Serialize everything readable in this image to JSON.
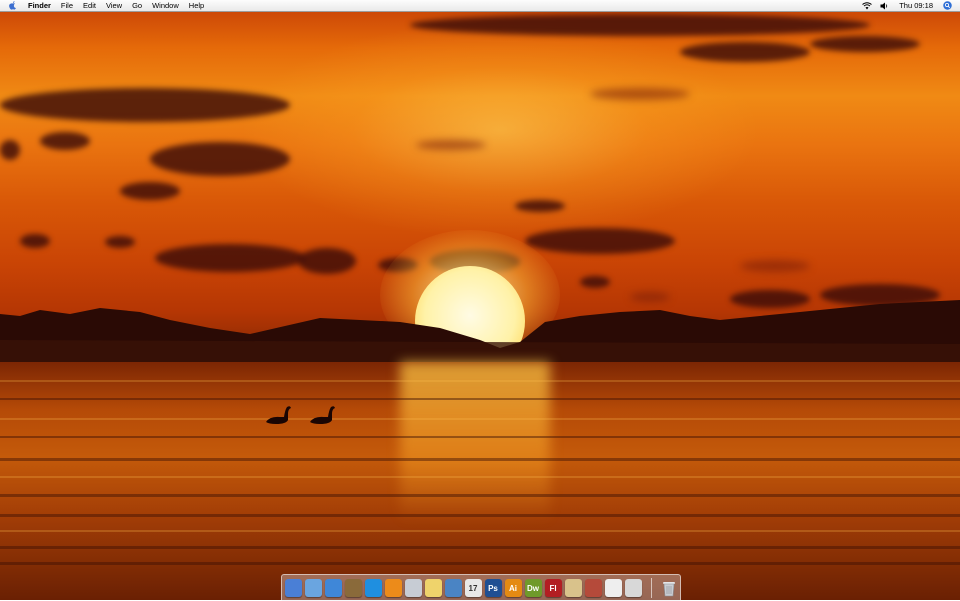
{
  "menubar": {
    "apple_icon": "apple-logo-icon",
    "app_name": "Finder",
    "menus": [
      "File",
      "Edit",
      "View",
      "Go",
      "Window",
      "Help"
    ],
    "status": {
      "wifi_icon": "wifi-icon",
      "volume_icon": "volume-icon",
      "clock": "Thu 09:18",
      "spotlight_icon": "spotlight-search-icon"
    }
  },
  "desktop": {
    "wallpaper": "sunset over water with two swans",
    "colors": {
      "sky": "#e56a09",
      "sun": "#fff2a8",
      "water": "#b54a07"
    }
  },
  "dock": {
    "items": [
      {
        "name": "finder",
        "icon": "finder-icon",
        "color": "#4a7fd6",
        "label": ""
      },
      {
        "name": "safari",
        "icon": "safari-compass-icon",
        "color": "#6aa5e0",
        "label": ""
      },
      {
        "name": "itunes",
        "icon": "itunes-music-icon",
        "color": "#3f87d8",
        "label": ""
      },
      {
        "name": "preview",
        "icon": "preview-photo-icon",
        "color": "#8a6a3a",
        "label": ""
      },
      {
        "name": "blue-app",
        "icon": "blue-circle-app-icon",
        "color": "#1f8fe0",
        "label": ""
      },
      {
        "name": "vlc",
        "icon": "vlc-cone-icon",
        "color": "#ec8b1a",
        "label": ""
      },
      {
        "name": "mail",
        "icon": "mail-pen-icon",
        "color": "#c7ccd4",
        "label": ""
      },
      {
        "name": "stickies",
        "icon": "notes-icon",
        "color": "#efd36b",
        "label": ""
      },
      {
        "name": "dashboard",
        "icon": "dashboard-gauge-icon",
        "color": "#4a84c4",
        "label": ""
      },
      {
        "name": "ical",
        "icon": "calendar-icon",
        "color": "#e8e8e8",
        "label": "17"
      },
      {
        "name": "photoshop",
        "icon": "photoshop-icon",
        "color": "#1f4f93",
        "label": "Ps"
      },
      {
        "name": "illustrator",
        "icon": "illustrator-icon",
        "color": "#e48a12",
        "label": "Ai"
      },
      {
        "name": "dreamweaver",
        "icon": "dreamweaver-icon",
        "color": "#6f9a2a",
        "label": "Dw"
      },
      {
        "name": "flash",
        "icon": "flash-icon",
        "color": "#b21e22",
        "label": "Fl"
      },
      {
        "name": "app-store",
        "icon": "package-icon",
        "color": "#d9c28b",
        "label": ""
      },
      {
        "name": "utility",
        "icon": "tools-icon",
        "color": "#b54a3a",
        "label": ""
      },
      {
        "name": "textedit",
        "icon": "document-icon",
        "color": "#eeeeee",
        "label": ""
      },
      {
        "name": "system-preferences",
        "icon": "apple-prefs-icon",
        "color": "#d8d8d8",
        "label": ""
      }
    ],
    "trash": {
      "name": "trash",
      "icon": "trash-can-icon",
      "color": "#c9ccd2"
    }
  }
}
